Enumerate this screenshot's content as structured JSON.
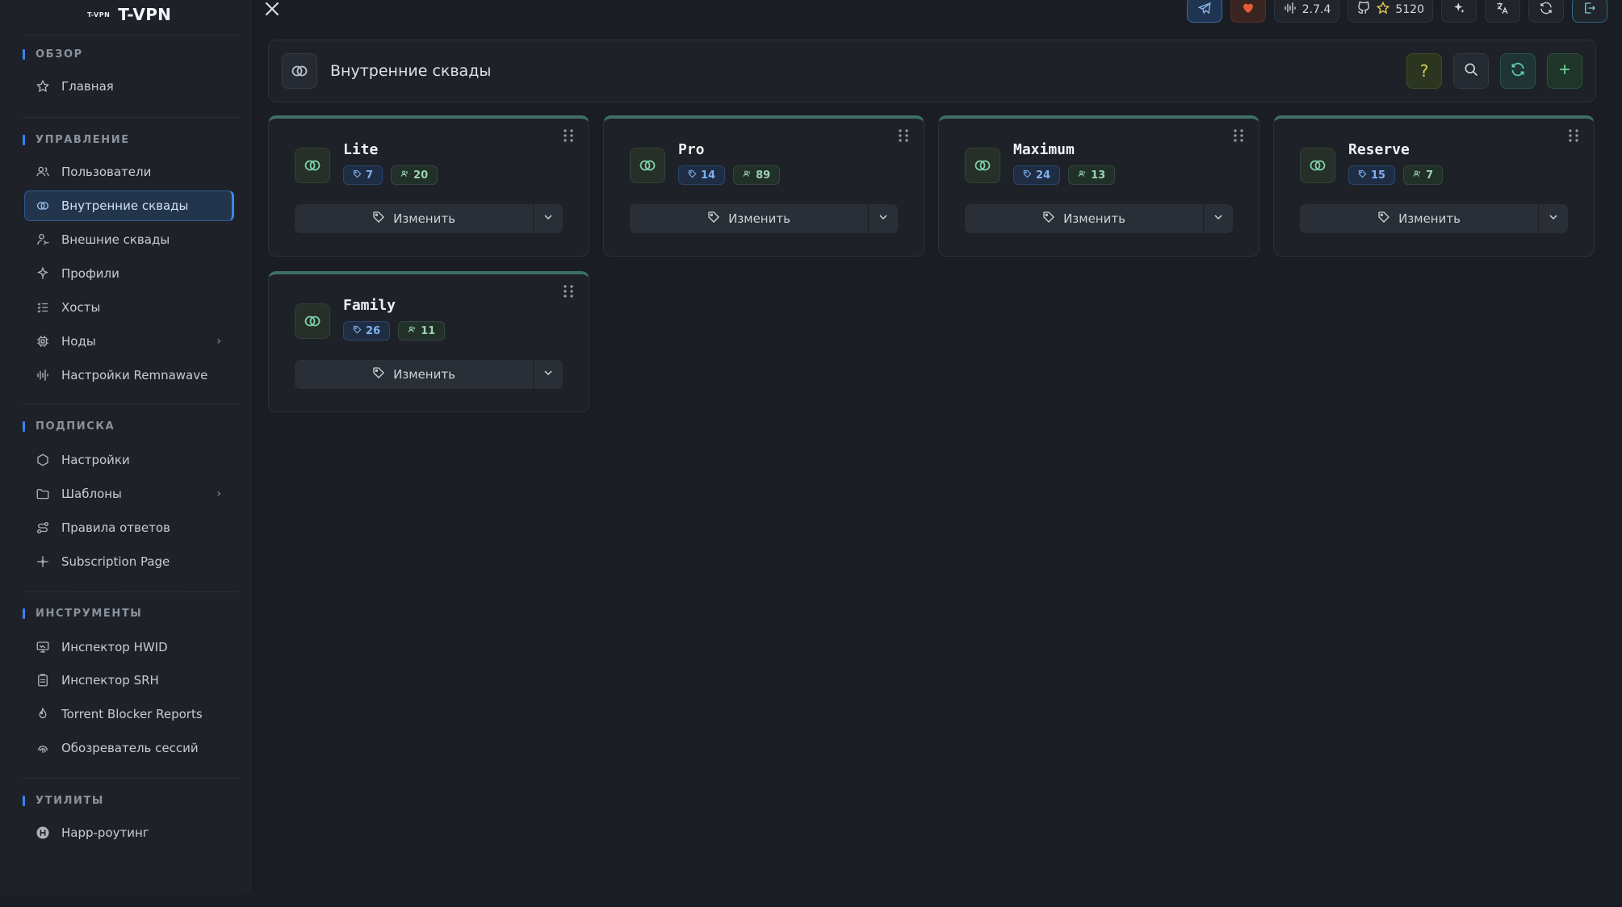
{
  "brand": {
    "small": "T-VPN",
    "name": "T-VPN"
  },
  "sidebar": {
    "sections": [
      {
        "title": "ОБЗОР"
      },
      {
        "title": "УПРАВЛЕНИЕ"
      },
      {
        "title": "ПОДПИСКА"
      },
      {
        "title": "ИНСТРУМЕНТЫ"
      },
      {
        "title": "УТИЛИТЫ"
      }
    ],
    "items": [
      {
        "label": "Главная",
        "icon": "star-icon"
      },
      {
        "label": "Пользователи",
        "icon": "users-icon"
      },
      {
        "label": "Внутренние сквады",
        "icon": "rings-icon",
        "active": true
      },
      {
        "label": "Внешние сквады",
        "icon": "external-icon"
      },
      {
        "label": "Профили",
        "icon": "profile-icon"
      },
      {
        "label": "Хосты",
        "icon": "list-icon"
      },
      {
        "label": "Ноды",
        "icon": "cpu-icon",
        "expandable": true
      },
      {
        "label": "Настройки Remnawave",
        "icon": "equalizer-icon"
      },
      {
        "label": "Настройки",
        "icon": "hexagon-icon"
      },
      {
        "label": "Шаблоны",
        "icon": "folder-icon",
        "expandable": true
      },
      {
        "label": "Правила ответов",
        "icon": "route-icon"
      },
      {
        "label": "Subscription Page",
        "icon": "sparkle-icon"
      },
      {
        "label": "Инспектор HWID",
        "icon": "monitor-icon"
      },
      {
        "label": "Инспектор SRH",
        "icon": "clipboard-icon"
      },
      {
        "label": "Torrent Blocker Reports",
        "icon": "flame-icon"
      },
      {
        "label": "Обозреватель сессий",
        "icon": "fingerprint-icon"
      },
      {
        "label": "Happ-роутинг",
        "icon": "happ-icon"
      }
    ]
  },
  "topbar": {
    "version": "2.7.4",
    "stars": "5120"
  },
  "header": {
    "title": "Внутренние сквады",
    "help_label": "?"
  },
  "cards": [
    {
      "name": "Lite",
      "tags": "7",
      "users": "20",
      "edit_label": "Изменить"
    },
    {
      "name": "Pro",
      "tags": "14",
      "users": "89",
      "edit_label": "Изменить"
    },
    {
      "name": "Maximum",
      "tags": "24",
      "users": "13",
      "edit_label": "Изменить"
    },
    {
      "name": "Reserve",
      "tags": "15",
      "users": "7",
      "edit_label": "Изменить"
    },
    {
      "name": "Family",
      "tags": "26",
      "users": "11",
      "edit_label": "Изменить"
    }
  ],
  "colors": {
    "accent": "#3b82f6",
    "card_top": "#3f6f66",
    "background": "#1a1d23"
  }
}
